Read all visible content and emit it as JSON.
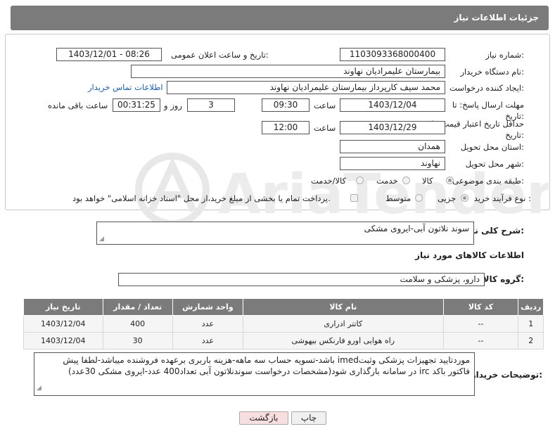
{
  "header": {
    "title": "جزئیات اطلاعات نیاز"
  },
  "form": {
    "need_number_label": "شماره نیاز:",
    "need_number": "1103093368000400",
    "announce_label": "تاریخ و ساعت اعلان عمومی:",
    "announce_value": "1403/12/01 - 08:26",
    "buyer_org_label": "نام دستگاه خریدار:",
    "buyer_org": "بیمارستان علیمرادیان نهاوند",
    "requester_label": "ایجاد کننده درخواست:",
    "requester": "محمد سیف کارپرداز بیمارستان علیمرادیان نهاوند",
    "contact_link": "اطلاعات تماس خریدار",
    "deadline_label": "مهلت ارسال پاسخ: تا تاریخ:",
    "deadline_date": "1403/12/04",
    "time_label": "ساعت",
    "deadline_time": "09:30",
    "days_count": "3",
    "days_label": "روز و",
    "remaining_time": "00:31:25",
    "remaining_label": "ساعت باقی مانده",
    "validity_label": "حداقل تاریخ اعتبار قیمت: تا تاریخ:",
    "validity_date": "1403/12/29",
    "validity_time": "12:00",
    "province_label": "استان محل تحویل:",
    "province": "همدان",
    "city_label": "شهر محل تحویل:",
    "city": "نهاوند",
    "category_label": "طبقه بندی موضوعی:",
    "category_options": [
      "کالا",
      "خدمت",
      "کالا/خدمت"
    ],
    "process_label": "نوع فرآیند خرید :",
    "process_options": [
      "جزیی",
      "متوسط"
    ],
    "payment_note": "پرداخت تمام یا بخشی از مبلغ خرید،از محل \"اسناد خزانه اسلامی\" خواهد بود."
  },
  "description": {
    "label": "شرح کلی نیاز:",
    "value": "سوند نلاتون آبی-ایروی مشکی"
  },
  "goods": {
    "section_title": "اطلاعات کالاهای مورد نیاز",
    "group_label": "گروه کالا:",
    "group_value": "دارو، پزشکی و سلامت",
    "columns": [
      "ردیف",
      "کد کالا",
      "نام کالا",
      "واحد شمارش",
      "تعداد / مقدار",
      "تاریخ نیاز"
    ],
    "rows": [
      [
        "1",
        "--",
        "کاتتر ادراری",
        "عدد",
        "400",
        "1403/12/04"
      ],
      [
        "2",
        "--",
        "راه هوایی اورو فارنکس بیهوشی",
        "عدد",
        "30",
        "1403/12/04"
      ]
    ]
  },
  "buyer_notes": {
    "label": "توضیحات خریدار:",
    "value": "موردتایید تجهیزات پزشکی وثبتimed باشد-تسویه حساب سه ماهه-هزینه باربری برعهده فروشنده میباشد-لطفا پیش فاکتور باکد irc در سامانه بارگذاری شود(مشخصات درخواست سوندنلاتون آبی تعداد400 عدد-ایروی مشکی 30عدد)"
  },
  "buttons": {
    "print": "چاپ",
    "back": "بازگشت"
  },
  "watermark": {
    "text": "AriaTender.net"
  },
  "colors": {
    "header_bg": "#7b7b7b",
    "link": "#1a5fb4",
    "back_button_bg": "#f8dede",
    "watermark": "#e6e6e6"
  }
}
